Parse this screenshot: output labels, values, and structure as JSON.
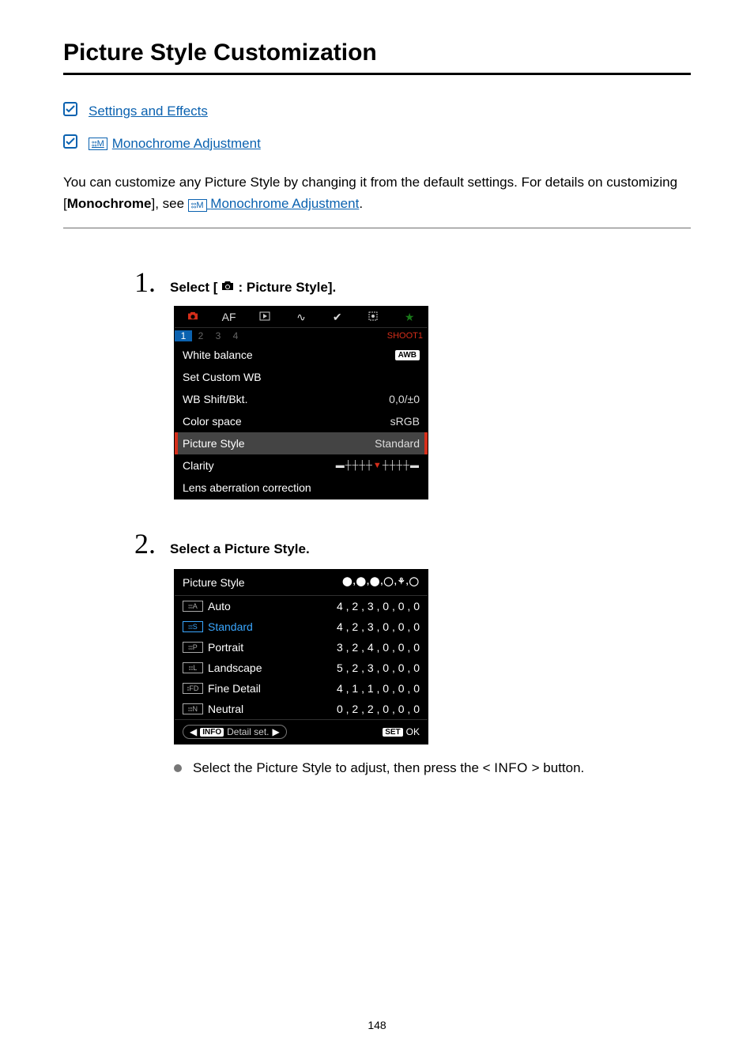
{
  "title": "Picture Style Customization",
  "toc": {
    "item1": "Settings and Effects",
    "item2": "Monochrome Adjustment"
  },
  "desc": {
    "p1a": "You can customize any Picture Style by changing it from the default settings. For details on customizing [",
    "mono": "Monochrome",
    "p1b": "], see ",
    "link": "Monochrome Adjustment",
    "p1c": "."
  },
  "step1": {
    "num": "1.",
    "title_a": "Select [",
    "title_b": ": Picture Style].",
    "tabs": {
      "cam": "●",
      "af": "AF",
      "play": "▶",
      "net": "∿",
      "wrench": "🔧",
      "cfn": "⚙",
      "star": "★",
      "shoot": "SHOOT1"
    },
    "sub": [
      "1",
      "2",
      "3",
      "4"
    ],
    "rows": {
      "wb": {
        "label": "White balance",
        "value_badge": "AWB"
      },
      "custom": {
        "label": "Set Custom WB"
      },
      "shift": {
        "label": "WB Shift/Bkt.",
        "value": "0,0/±0"
      },
      "cspace": {
        "label": "Color space",
        "value": "sRGB"
      },
      "pstyle": {
        "label": "Picture Style",
        "value": "Standard"
      },
      "clarity": {
        "label": "Clarity"
      },
      "lens": {
        "label": "Lens aberration correction"
      }
    }
  },
  "step2": {
    "num": "2.",
    "title": "Select a Picture Style.",
    "head_label": "Picture Style",
    "head_icons": "⬤,⬤,⬤,◯,♣,◯",
    "styles": [
      {
        "badge": "A",
        "name": "Auto",
        "vals": "4 , 2 , 3 , 0 , 0 , 0"
      },
      {
        "badge": "S",
        "name": "Standard",
        "vals": "4 , 2 , 3 , 0 , 0 , 0"
      },
      {
        "badge": "P",
        "name": "Portrait",
        "vals": "3 , 2 , 4 , 0 , 0 , 0"
      },
      {
        "badge": "L",
        "name": "Landscape",
        "vals": "5 , 2 , 3 , 0 , 0 , 0"
      },
      {
        "badge": "FD",
        "name": "Fine Detail",
        "vals": "4 , 1 , 1 , 0 , 0 , 0"
      },
      {
        "badge": "N",
        "name": "Neutral",
        "vals": "0 , 2 , 2 , 0 , 0 , 0"
      }
    ],
    "foot": {
      "info": "INFO",
      "detail": "Detail set.",
      "set": "SET",
      "ok": "OK"
    },
    "bullet_a": "Select the Picture Style to adjust, then press the < ",
    "bullet_btn": "INFO",
    "bullet_b": " > button."
  },
  "pagenum": "148"
}
